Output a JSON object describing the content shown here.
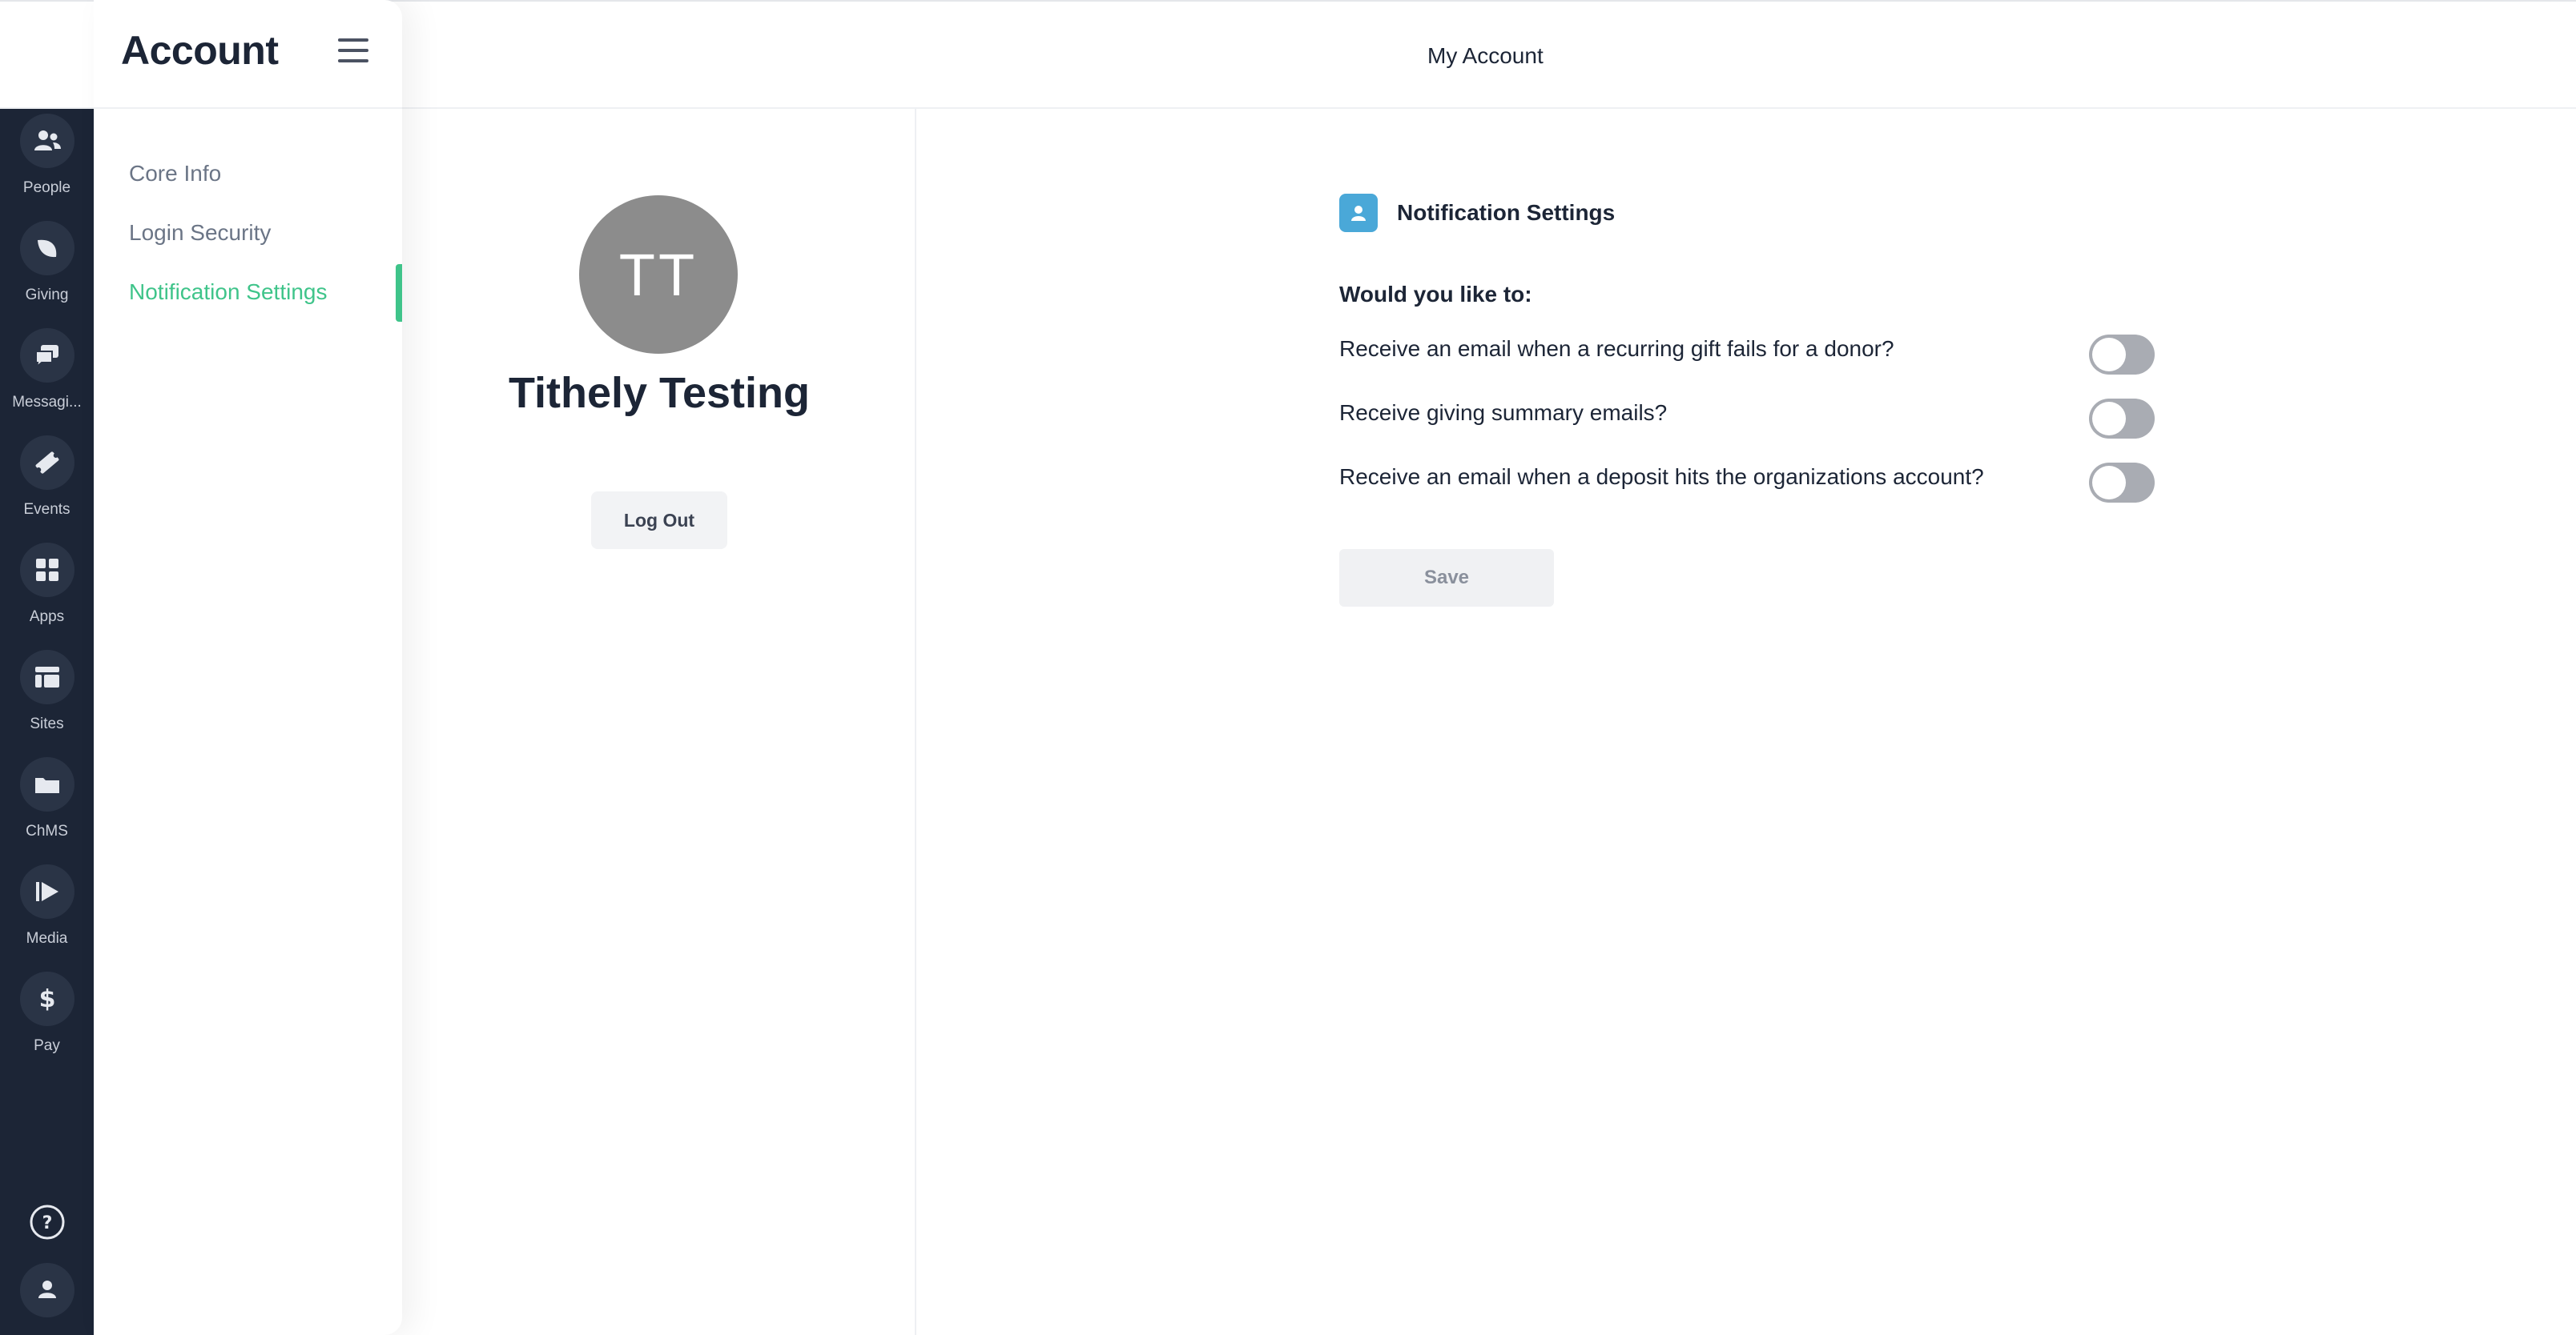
{
  "rail": {
    "items": [
      {
        "label": "People",
        "icon": "people-icon"
      },
      {
        "label": "Giving",
        "icon": "leaf-icon"
      },
      {
        "label": "Messagi...",
        "icon": "chat-icon"
      },
      {
        "label": "Events",
        "icon": "ticket-icon"
      },
      {
        "label": "Apps",
        "icon": "apps-grid-icon"
      },
      {
        "label": "Sites",
        "icon": "layout-icon"
      },
      {
        "label": "ChMS",
        "icon": "folder-icon"
      },
      {
        "label": "Media",
        "icon": "play-icon"
      },
      {
        "label": "Pay",
        "icon": "dollar-icon"
      }
    ],
    "bottom": [
      {
        "icon": "help-icon"
      },
      {
        "icon": "user-icon"
      }
    ]
  },
  "sidebar": {
    "title": "Account",
    "items": [
      {
        "label": "Core Info",
        "active": false
      },
      {
        "label": "Login Security",
        "active": false
      },
      {
        "label": "Notification Settings",
        "active": true
      }
    ]
  },
  "header": {
    "title": "My Account"
  },
  "profile": {
    "initials": "TT",
    "name": "Tithely Testing",
    "logout_label": "Log Out"
  },
  "notifications": {
    "title": "Notification Settings",
    "question": "Would you like to:",
    "options": [
      {
        "label": "Receive an email when a recurring gift fails for a donor?",
        "enabled": false
      },
      {
        "label": "Receive giving summary emails?",
        "enabled": false
      },
      {
        "label": "Receive an email when a deposit hits the organizations account?",
        "enabled": false
      }
    ],
    "save_label": "Save"
  },
  "colors": {
    "rail_bg": "#1c2536",
    "accent_green": "#3fc48a",
    "icon_blue": "#4aa8d8",
    "avatar_gray": "#8c8c8c",
    "toggle_off": "#a9acb3"
  }
}
